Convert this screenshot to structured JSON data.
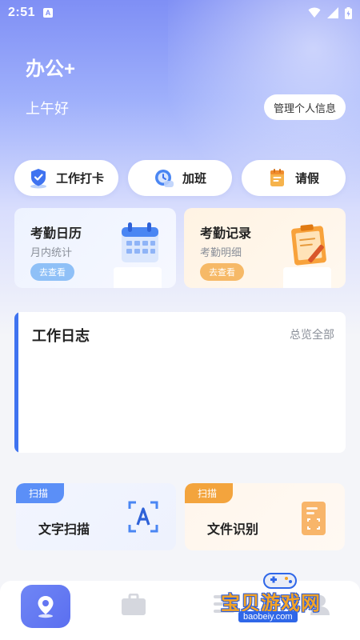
{
  "status_bar": {
    "time": "2:51",
    "notification_badge": "A"
  },
  "header": {
    "app_title": "办公+",
    "greeting": "上午好",
    "profile_button": "管理个人信息"
  },
  "quick_actions": [
    {
      "label": "工作打卡",
      "icon": "clock-in-shield-icon"
    },
    {
      "label": "加班",
      "icon": "overtime-clock-icon"
    },
    {
      "label": "请假",
      "icon": "leave-note-icon"
    }
  ],
  "cards": {
    "attendance_calendar": {
      "title": "考勤日历",
      "subtitle": "月内统计",
      "button": "去查看"
    },
    "attendance_records": {
      "title": "考勤记录",
      "subtitle": "考勤明细",
      "button": "去查看"
    }
  },
  "work_log": {
    "title": "工作日志",
    "view_all": "总览全部"
  },
  "scan_tools": {
    "text_scan": {
      "tag": "扫描",
      "label": "文字扫描"
    },
    "file_recognition": {
      "tag": "扫描",
      "label": "文件识别"
    }
  },
  "watermark": {
    "title": "宝贝游戏网",
    "url": "baobeiy.com"
  },
  "colors": {
    "accent_blue": "#3f73f0",
    "orange": "#f3a43d",
    "hero_top": "#7f8ff5"
  }
}
